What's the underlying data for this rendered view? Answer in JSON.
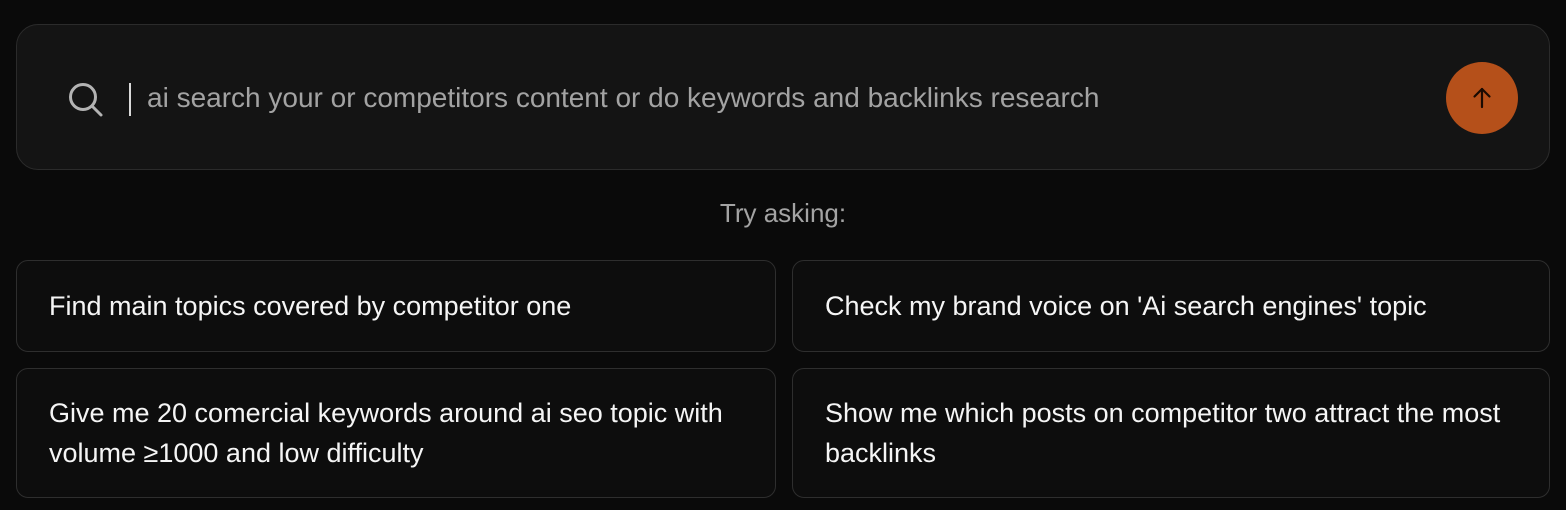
{
  "search": {
    "placeholder": "ai search your or competitors content or do keywords and backlinks research",
    "value": "",
    "search_icon": "search-icon",
    "submit_icon": "arrow-up-icon",
    "submit_color": "#b5501a"
  },
  "suggestions_header": "Try asking:",
  "suggestions": [
    {
      "label": "Find main topics covered by competitor one"
    },
    {
      "label": "Check my brand voice on 'Ai search engines' topic"
    },
    {
      "label": "Give me 20 comercial keywords around ai seo topic with volume ≥1000 and low difficulty"
    },
    {
      "label": "Show me which posts on competitor two attract the most backlinks"
    }
  ]
}
